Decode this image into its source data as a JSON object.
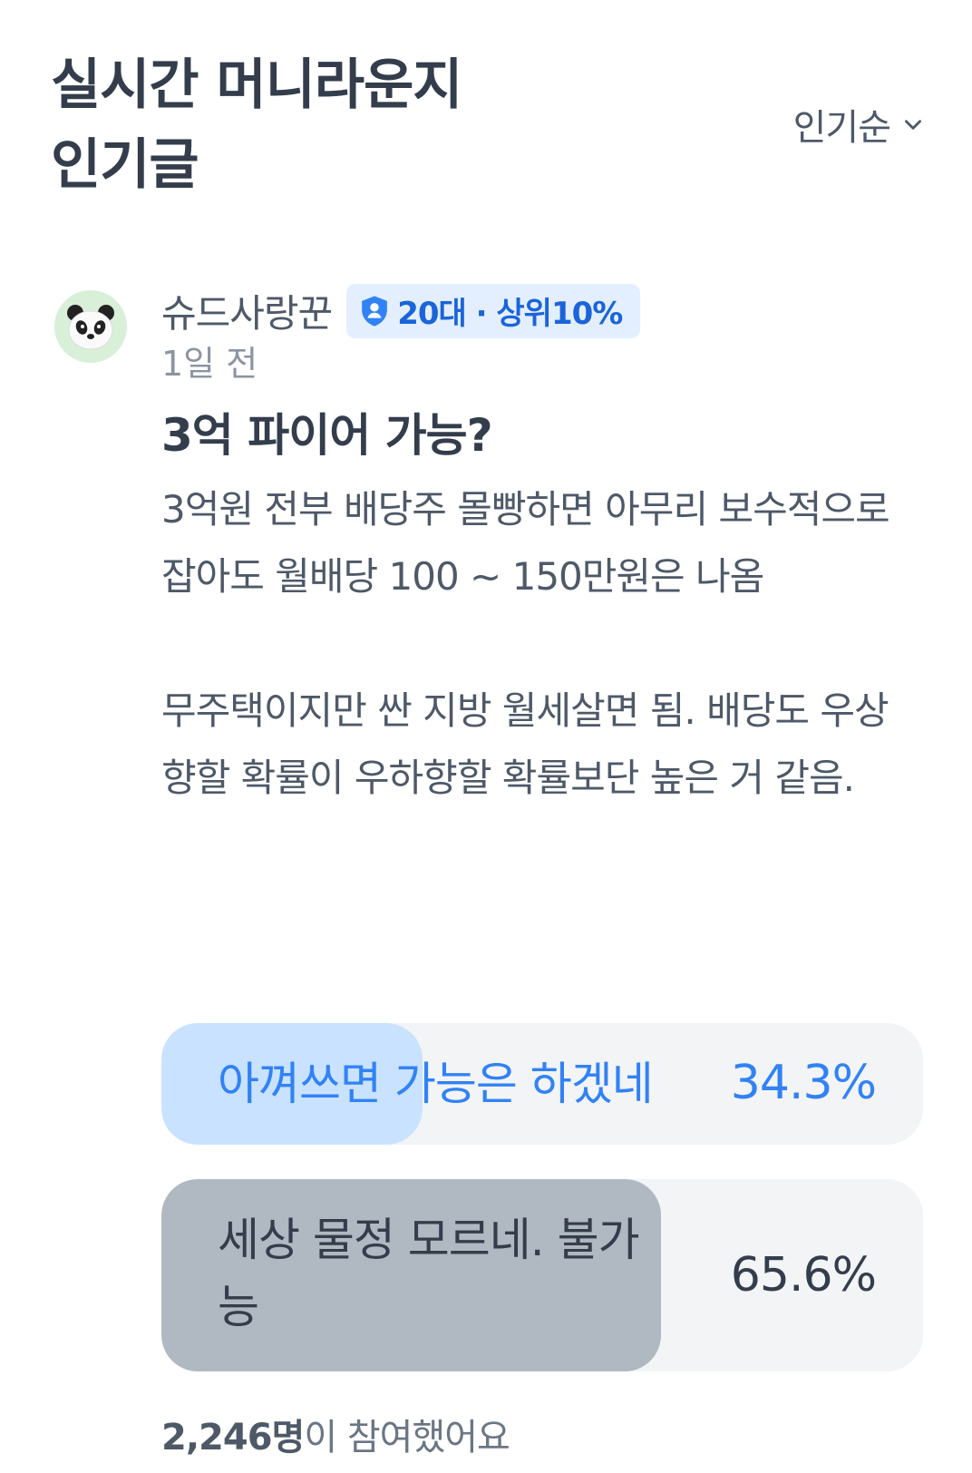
{
  "header": {
    "title_line1": "실시간 머니라운지",
    "title_line2": "인기글",
    "sort_label": "인기순"
  },
  "post": {
    "author": "슈드사랑꾼",
    "badge": "20대 · 상위10%",
    "time": "1일 전",
    "title": "3억 파이어 가능?",
    "body_para1": "3억원 전부 배당주 몰빵하면 아무리 보수적으로 잡아도 월배당 100 ~ 150만원은 나옴",
    "body_para2": "무주택이지만 싼 지방 월세살면 됨. 배당도 우상향할 확률이 우하향할 확률보단 높은 거 같음."
  },
  "poll": {
    "options": [
      {
        "label": "아껴쓰면 가능은 하겠네",
        "percent": "34.3%",
        "fill": 0.343
      },
      {
        "label": "세상 물정 모르네. 불가능",
        "percent": "65.6%",
        "fill": 0.656
      }
    ],
    "participants_count": "2,246명",
    "participants_suffix": "이 참여했어요"
  },
  "colors": {
    "accent": "#3182f6",
    "badge_bg": "#e3efff",
    "selected_fill": "#c9e2ff",
    "majority_fill": "#b0b8c1"
  },
  "icons": {
    "sort": "chevron-down-icon",
    "avatar": "panda-avatar",
    "badge": "shield-person-icon"
  }
}
